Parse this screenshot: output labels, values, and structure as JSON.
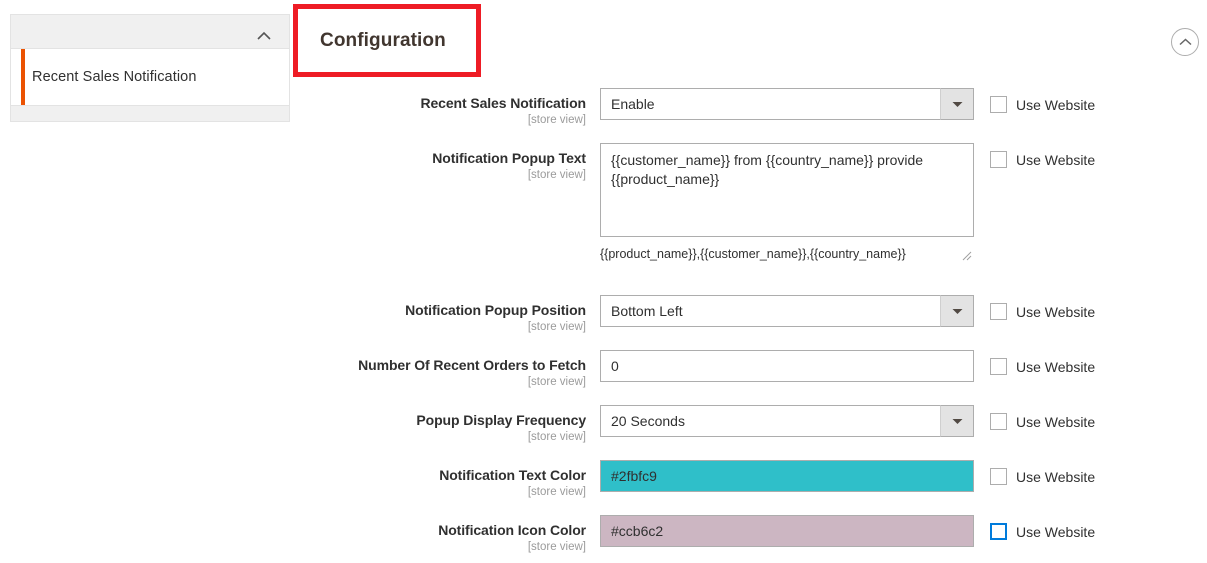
{
  "nav": {
    "section_toggle_icon": "chevron-up-icon",
    "items": [
      {
        "label": "Recent Sales Notification",
        "active": true
      }
    ]
  },
  "header": {
    "title": "Configuration",
    "highlight_color": "#ee1c25",
    "collapse_all_icon": "chevron-up-circle-icon"
  },
  "scope_label": "[store view]",
  "use_website_label": "Use Website",
  "fields": [
    {
      "label": "Recent Sales Notification",
      "scope": "[store view]",
      "type": "select",
      "value": "Enable",
      "name": "recent-sales-notification",
      "use_website_checked": false,
      "use_website_focused": false
    },
    {
      "label": "Notification Popup Text",
      "scope": "[store view]",
      "type": "textarea",
      "value": "{{customer_name}} from  {{country_name}} provide {{product_name}}",
      "hint": "{{product_name}},{{customer_name}},{{country_name}}",
      "name": "notification-popup-text",
      "use_website_checked": false,
      "use_website_focused": false
    },
    {
      "label": "Notification Popup Position",
      "scope": "[store view]",
      "type": "select",
      "value": "Bottom Left",
      "name": "notification-popup-position",
      "use_website_checked": false,
      "use_website_focused": false
    },
    {
      "label": "Number Of Recent Orders to Fetch",
      "scope": "[store view]",
      "type": "text",
      "value": "0",
      "name": "number-of-recent-orders-to-fetch",
      "use_website_checked": false,
      "use_website_focused": false
    },
    {
      "label": "Popup Display Frequency",
      "scope": "[store view]",
      "type": "select",
      "value": "20 Seconds",
      "name": "popup-display-frequency",
      "use_website_checked": false,
      "use_website_focused": false
    },
    {
      "label": "Notification Text Color",
      "scope": "[store view]",
      "type": "color",
      "value": "#2fbfc9",
      "swatch": "#2fbfc9",
      "name": "notification-text-color",
      "use_website_checked": false,
      "use_website_focused": false
    },
    {
      "label": "Notification Icon Color",
      "scope": "[store view]",
      "type": "color",
      "value": "#ccb6c2",
      "swatch": "#ccb6c2",
      "name": "notification-icon-color",
      "use_website_checked": false,
      "use_website_focused": true
    }
  ]
}
